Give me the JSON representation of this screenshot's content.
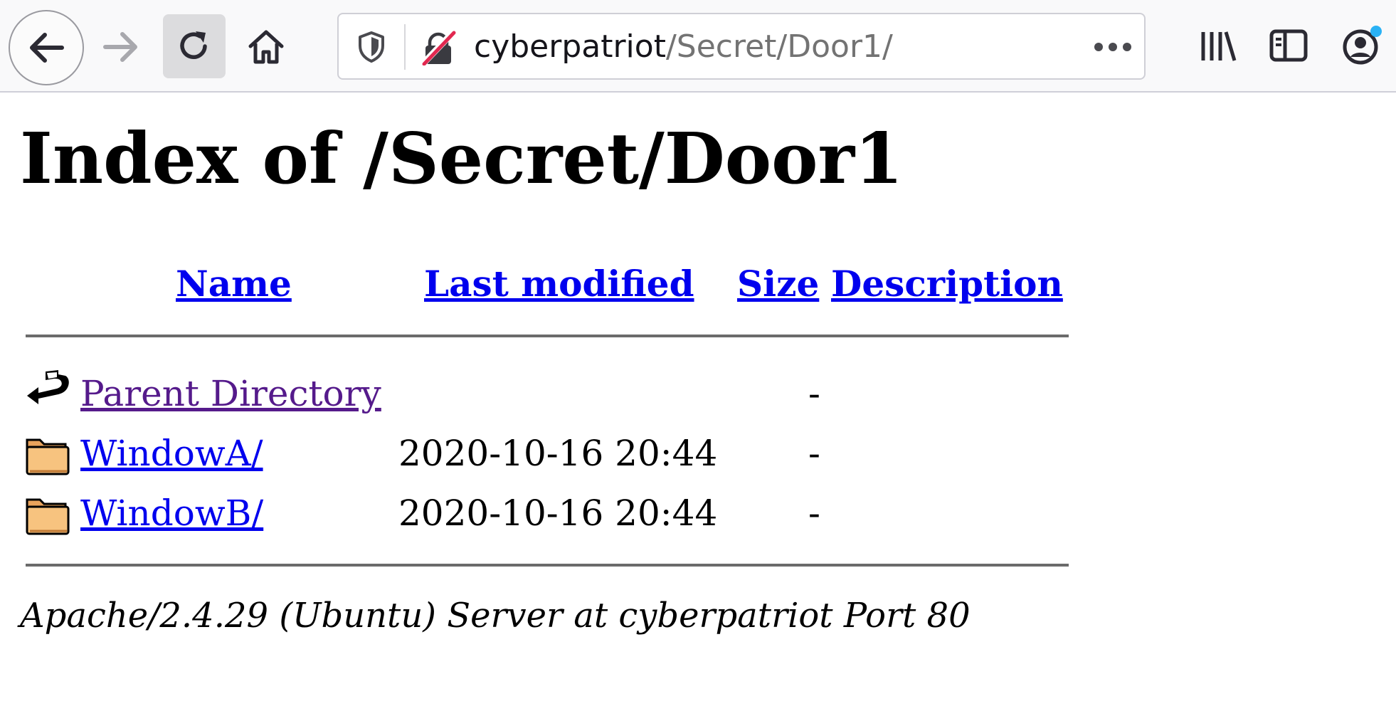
{
  "browser": {
    "url_host": "cyberpatriot",
    "url_path": "/Secret/Door1/"
  },
  "page": {
    "title": "Index of /Secret/Door1",
    "columns": {
      "name": "Name",
      "last_modified": "Last modified",
      "size": "Size",
      "description": "Description"
    },
    "entries": [
      {
        "name": "Parent Directory",
        "modified": "",
        "size": "-",
        "icon": "back-icon"
      },
      {
        "name": "WindowA/",
        "modified": "2020-10-16 20:44",
        "size": "-",
        "icon": "folder-icon"
      },
      {
        "name": "WindowB/",
        "modified": "2020-10-16 20:44",
        "size": "-",
        "icon": "folder-icon"
      }
    ],
    "footer": "Apache/2.4.29 (Ubuntu) Server at cyberpatriot Port 80"
  },
  "colors": {
    "link": "#0000ee",
    "visited_link": "#551a8b",
    "folder": "#f7c37f",
    "notification_dot": "#2ab2f5"
  }
}
